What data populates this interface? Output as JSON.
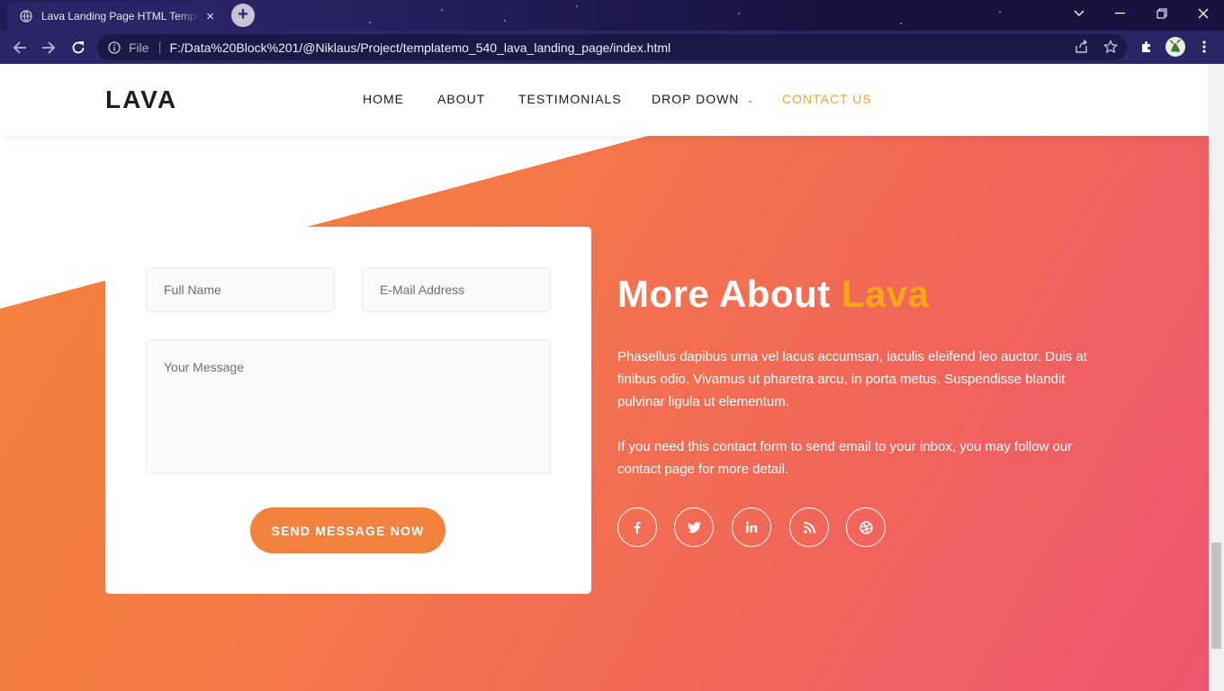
{
  "browser": {
    "tab_title": "Lava Landing Page HTML Template",
    "tab_close": "×",
    "new_tab": "+",
    "address_scheme": "File",
    "address_url": "F:/Data%20Block%201/@Niklaus/Project/templatemo_540_lava_landing_page/index.html",
    "icons": [
      "globe-icon",
      "back-arrow-icon",
      "forward-arrow-icon",
      "reload-icon",
      "info-icon",
      "share-icon",
      "bookmark-star-icon",
      "extensions-icon",
      "profile-avatar",
      "kebab-menu-icon",
      "chevron-down-icon",
      "minimize-icon",
      "restore-icon",
      "close-icon"
    ]
  },
  "site": {
    "logo": "LAVA",
    "nav": {
      "home": "HOME",
      "about": "ABOUT",
      "testimonials": "TESTIMONIALS",
      "dropdown": "DROP DOWN",
      "contact": "CONTACT US"
    },
    "accent_color": "#f7a51b",
    "gradient_colors": [
      "#f5823c",
      "#ef5570"
    ]
  },
  "form": {
    "name_placeholder": "Full Name",
    "email_placeholder": "E-Mail Address",
    "message_placeholder": "Your Message",
    "submit_label": "SEND MESSAGE NOW"
  },
  "about": {
    "title_main": "More About ",
    "title_accent": "Lava",
    "paragraph1": "Phasellus dapibus urna vel lacus accumsan, iaculis eleifend leo auctor. Duis at finibus odio. Vivamus ut pharetra arcu, in porta metus. Suspendisse blandit pulvinar ligula ut elementum.",
    "paragraph2": "If you need this contact form to send email to your inbox, you may follow our contact page for more detail.",
    "social": [
      "facebook-icon",
      "twitter-icon",
      "linkedin-icon",
      "rss-icon",
      "dribbble-icon"
    ]
  }
}
